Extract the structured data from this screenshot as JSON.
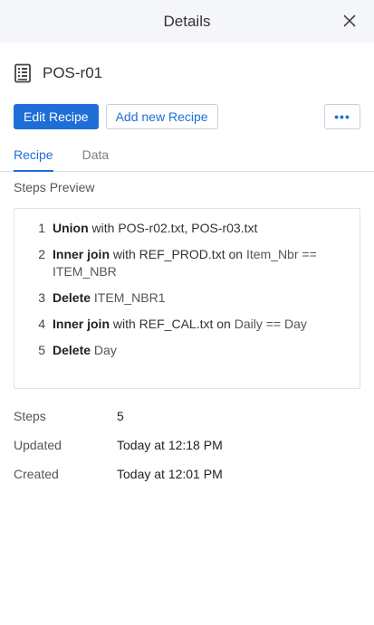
{
  "header": {
    "title": "Details"
  },
  "recipe": {
    "name": "POS-r01"
  },
  "actions": {
    "edit_label": "Edit Recipe",
    "add_label": "Add new Recipe",
    "more_label": "•••"
  },
  "tabs": [
    {
      "label": "Recipe",
      "active": true
    },
    {
      "label": "Data",
      "active": false
    }
  ],
  "steps_preview": {
    "label": "Steps Preview",
    "steps": [
      {
        "num": "1",
        "parts": [
          {
            "t": "Union",
            "k": "kw"
          },
          {
            "t": " with POS-r02.txt, POS-r03.txt",
            "k": ""
          }
        ]
      },
      {
        "num": "2",
        "parts": [
          {
            "t": "Inner join",
            "k": "kw"
          },
          {
            "t": " with REF_PROD.txt on ",
            "k": ""
          },
          {
            "t": "Item_Nbr == ITEM_NBR",
            "k": "col"
          }
        ]
      },
      {
        "num": "3",
        "parts": [
          {
            "t": "Delete",
            "k": "kw"
          },
          {
            "t": " ",
            "k": ""
          },
          {
            "t": "ITEM_NBR1",
            "k": "col"
          }
        ]
      },
      {
        "num": "4",
        "parts": [
          {
            "t": "Inner join",
            "k": "kw"
          },
          {
            "t": " with REF_CAL.txt on ",
            "k": ""
          },
          {
            "t": "Daily == Day",
            "k": "col"
          }
        ]
      },
      {
        "num": "5",
        "parts": [
          {
            "t": "Delete",
            "k": "kw"
          },
          {
            "t": " ",
            "k": ""
          },
          {
            "t": "Day",
            "k": "col"
          }
        ]
      }
    ]
  },
  "meta": [
    {
      "key": "Steps",
      "value": "5"
    },
    {
      "key": "Updated",
      "value": "Today at 12:18 PM"
    },
    {
      "key": "Created",
      "value": "Today at 12:01 PM"
    }
  ],
  "colors": {
    "accent": "#1f6ed8",
    "header_bg": "#f4f6f9"
  }
}
